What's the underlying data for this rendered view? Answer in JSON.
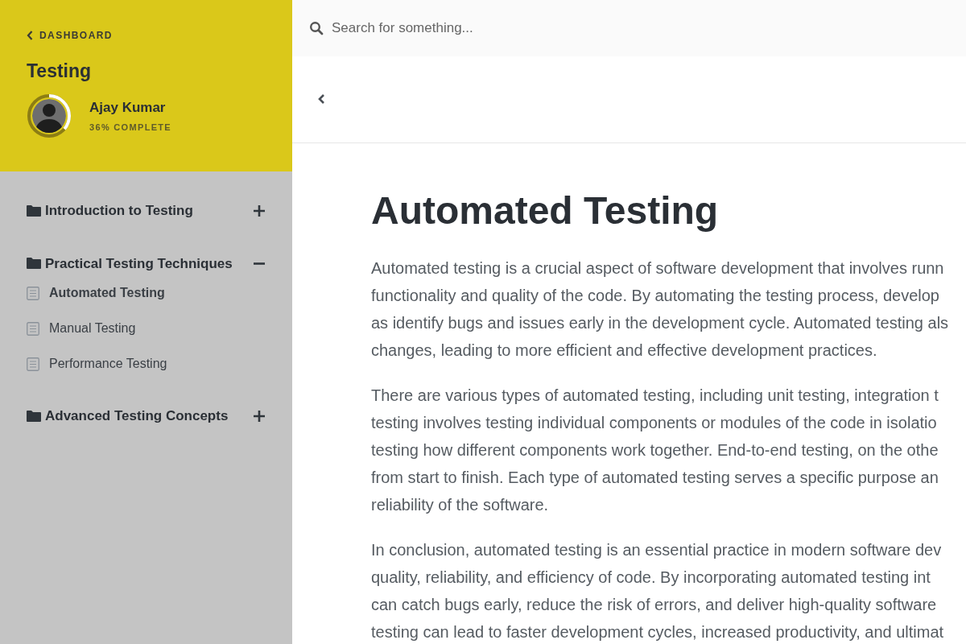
{
  "sidebar": {
    "back_link": "DASHBOARD",
    "course_title": "Testing",
    "user": {
      "name": "Ajay Kumar",
      "progress_text": "36% COMPLETE",
      "level": 0.36
    },
    "sections": [
      {
        "title": "Introduction to Testing",
        "expanded": false
      },
      {
        "title": "Practical Testing Techniques",
        "expanded": true,
        "lessons": [
          {
            "title": "Automated Testing",
            "selected": true
          },
          {
            "title": "Manual Testing",
            "selected": false
          },
          {
            "title": "Performance Testing",
            "selected": false
          }
        ]
      },
      {
        "title": "Advanced Testing Concepts",
        "expanded": false
      }
    ]
  },
  "search": {
    "placeholder": "Search for something..."
  },
  "article": {
    "title": "Automated Testing",
    "paragraphs": [
      [
        "Automated testing is a crucial aspect of software development that involves runn",
        "functionality and quality of the code. By automating the testing process, develop",
        "as identify bugs and issues early in the development cycle. Automated testing als",
        "changes, leading to more efficient and effective development practices."
      ],
      [
        "There are various types of automated testing, including unit testing, integration t",
        "testing involves testing individual components or modules of the code in isolatio",
        "testing how different components work together. End-to-end testing, on the othe",
        "from start to finish. Each type of automated testing serves a specific purpose an",
        "reliability of the software."
      ],
      [
        "In conclusion, automated testing is an essential practice in modern software dev",
        "quality, reliability, and efficiency of code. By incorporating automated testing int",
        "can catch bugs early, reduce the risk of errors, and deliver high-quality software",
        "testing can lead to faster development cycles, increased productivity, and ultimat"
      ]
    ]
  }
}
